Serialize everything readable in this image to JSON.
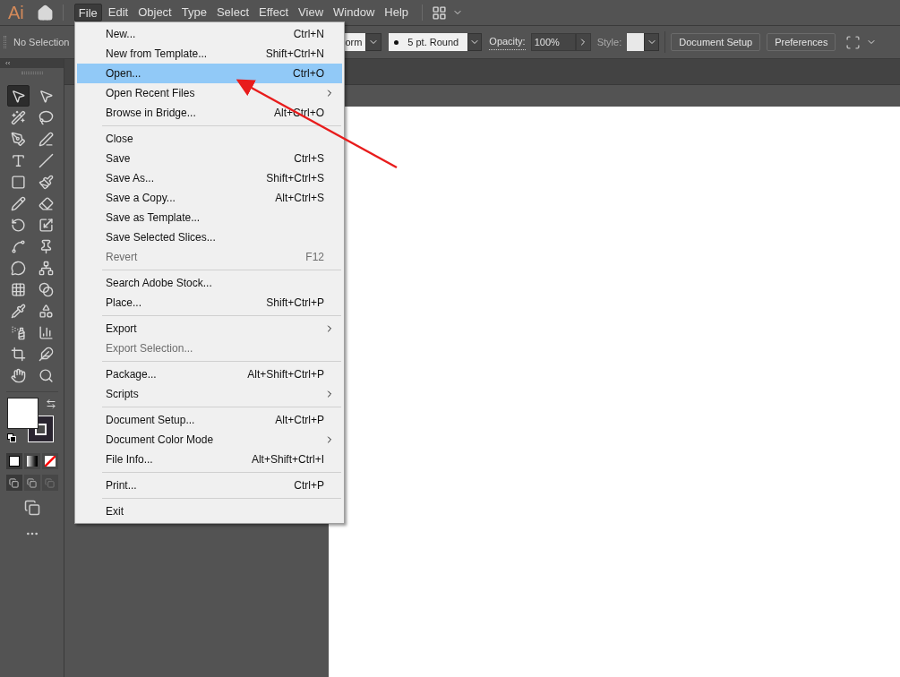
{
  "app_logo": "Ai",
  "menu_bar": [
    {
      "label": "File",
      "selected": true
    },
    {
      "label": "Edit",
      "selected": false
    },
    {
      "label": "Object",
      "selected": false
    },
    {
      "label": "Type",
      "selected": false
    },
    {
      "label": "Select",
      "selected": false
    },
    {
      "label": "Effect",
      "selected": false
    },
    {
      "label": "View",
      "selected": false
    },
    {
      "label": "Window",
      "selected": false
    },
    {
      "label": "Help",
      "selected": false
    }
  ],
  "control_bar": {
    "selection_status": "No Selection",
    "profile_value": "orm",
    "brush_value": "5 pt. Round",
    "opacity_label": "Opacity:",
    "opacity_value": "100%",
    "style_label": "Style:",
    "buttons": [
      "Document Setup",
      "Preferences"
    ]
  },
  "tools": [
    {
      "selected": true
    },
    {
      "selected": false
    },
    {
      "selected": false
    },
    {
      "selected": false
    },
    {
      "selected": false
    },
    {
      "selected": false
    },
    {
      "selected": false
    },
    {
      "selected": false
    },
    {
      "selected": false
    },
    {
      "selected": false
    },
    {
      "selected": false
    },
    {
      "selected": false
    },
    {
      "selected": false
    },
    {
      "selected": false
    },
    {
      "selected": false
    },
    {
      "selected": false
    },
    {
      "selected": false
    },
    {
      "selected": false
    },
    {
      "selected": false
    },
    {
      "selected": false
    },
    {
      "selected": false
    },
    {
      "selected": false
    },
    {
      "selected": false
    },
    {
      "selected": false
    },
    {
      "selected": false
    },
    {
      "selected": false
    },
    {
      "selected": false
    },
    {
      "selected": false
    }
  ],
  "panel_collapse": "‹‹",
  "file_menu": [
    [
      {
        "label": "New...",
        "shortcut": "Ctrl+N",
        "submenu": false,
        "disabled": false,
        "selected": false
      },
      {
        "label": "New from Template...",
        "shortcut": "Shift+Ctrl+N",
        "submenu": false,
        "disabled": false,
        "selected": false
      },
      {
        "label": "Open...",
        "shortcut": "Ctrl+O",
        "submenu": false,
        "disabled": false,
        "selected": true
      },
      {
        "label": "Open Recent Files",
        "submenu": true,
        "disabled": false,
        "selected": false
      },
      {
        "label": "Browse in Bridge...",
        "shortcut": "Alt+Ctrl+O",
        "submenu": false,
        "disabled": false,
        "selected": false
      }
    ],
    [
      {
        "label": "Close",
        "submenu": false,
        "disabled": false,
        "selected": false
      },
      {
        "label": "Save",
        "shortcut": "Ctrl+S",
        "submenu": false,
        "disabled": false,
        "selected": false
      },
      {
        "label": "Save As...",
        "shortcut": "Shift+Ctrl+S",
        "submenu": false,
        "disabled": false,
        "selected": false
      },
      {
        "label": "Save a Copy...",
        "shortcut": "Alt+Ctrl+S",
        "submenu": false,
        "disabled": false,
        "selected": false
      },
      {
        "label": "Save as Template...",
        "submenu": false,
        "disabled": false,
        "selected": false
      },
      {
        "label": "Save Selected Slices...",
        "submenu": false,
        "disabled": false,
        "selected": false
      },
      {
        "label": "Revert",
        "shortcut": "F12",
        "submenu": false,
        "disabled": true,
        "selected": false
      }
    ],
    [
      {
        "label": "Search Adobe Stock...",
        "submenu": false,
        "disabled": false,
        "selected": false
      },
      {
        "label": "Place...",
        "shortcut": "Shift+Ctrl+P",
        "submenu": false,
        "disabled": false,
        "selected": false
      }
    ],
    [
      {
        "label": "Export",
        "submenu": true,
        "disabled": false,
        "selected": false
      },
      {
        "label": "Export Selection...",
        "submenu": false,
        "disabled": true,
        "selected": false
      }
    ],
    [
      {
        "label": "Package...",
        "shortcut": "Alt+Shift+Ctrl+P",
        "submenu": false,
        "disabled": false,
        "selected": false
      },
      {
        "label": "Scripts",
        "submenu": true,
        "disabled": false,
        "selected": false
      }
    ],
    [
      {
        "label": "Document Setup...",
        "shortcut": "Alt+Ctrl+P",
        "submenu": false,
        "disabled": false,
        "selected": false
      },
      {
        "label": "Document Color Mode",
        "submenu": true,
        "disabled": false,
        "selected": false
      },
      {
        "label": "File Info...",
        "shortcut": "Alt+Shift+Ctrl+I",
        "submenu": false,
        "disabled": false,
        "selected": false
      }
    ],
    [
      {
        "label": "Print...",
        "shortcut": "Ctrl+P",
        "submenu": false,
        "disabled": false,
        "selected": false
      }
    ],
    [
      {
        "label": "Exit",
        "submenu": false,
        "disabled": false,
        "selected": false
      }
    ]
  ]
}
